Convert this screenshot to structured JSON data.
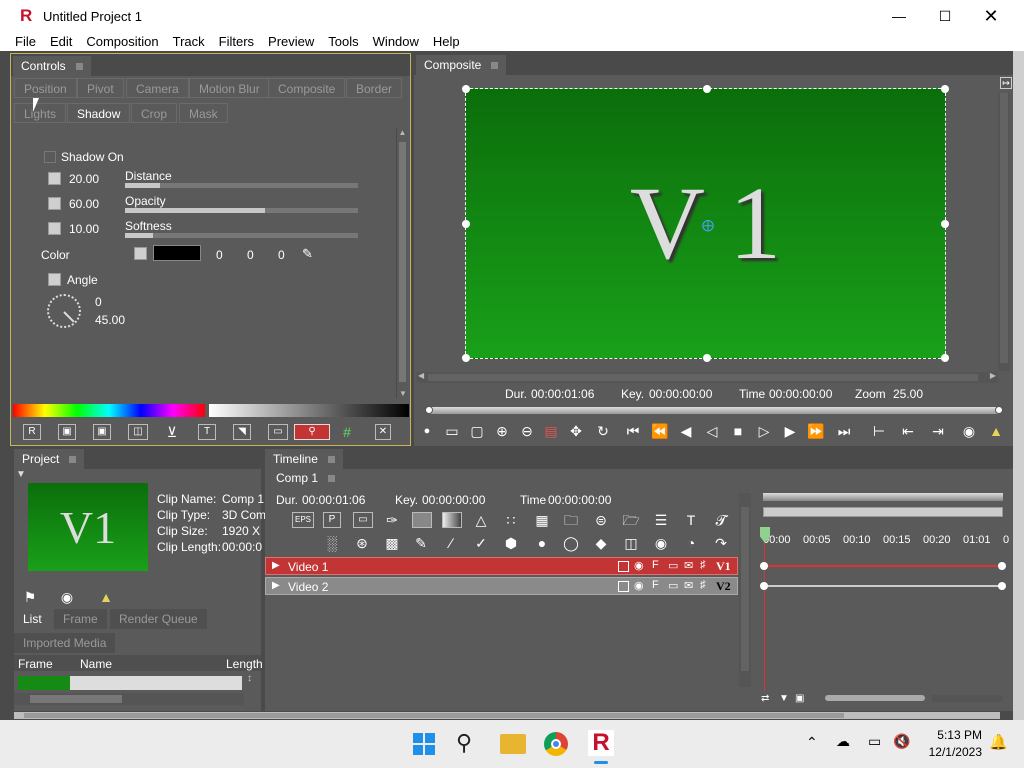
{
  "window": {
    "title": "Untitled Project 1"
  },
  "menu": [
    "File",
    "Edit",
    "Composition",
    "Track",
    "Filters",
    "Preview",
    "Tools",
    "Window",
    "Help"
  ],
  "controls": {
    "panel_title": "Controls",
    "tabs_row1": [
      "Position",
      "Pivot",
      "Camera",
      "Motion Blur",
      "Composite",
      "Border"
    ],
    "tabs_row2": [
      "Lights",
      "Shadow",
      "Crop",
      "Mask"
    ],
    "active_tab": "Shadow",
    "shadow_on_label": "Shadow On",
    "distance": {
      "value": "20.00",
      "label": "Distance",
      "level": 0.15
    },
    "opacity": {
      "value": "60.00",
      "label": "Opacity",
      "level": 0.6
    },
    "softness": {
      "value": "10.00",
      "label": "Softness",
      "level": 0.12
    },
    "color_label": "Color",
    "color_rgb": [
      "0",
      "0",
      "0"
    ],
    "color_value": "#000000",
    "angle_label": "Angle",
    "angle_values": [
      "0",
      "45.00"
    ]
  },
  "composite": {
    "panel_title": "Composite",
    "canvas_text": "V 1",
    "dur_label": "Dur.",
    "dur": "00:00:01:06",
    "key_label": "Key.",
    "key": "00:00:00:00",
    "time_label": "Time",
    "time": "00:00:00:00",
    "zoom_label": "Zoom",
    "zoom": "25.00",
    "bg_top": "#0b6e0b",
    "bg_bottom": "#19a019"
  },
  "project": {
    "panel_title": "Project",
    "thumb_text": "V1",
    "info": [
      {
        "label": "Clip Name:",
        "value": "Comp 1"
      },
      {
        "label": "Clip Type:",
        "value": "3D Com"
      },
      {
        "label": "Clip Size:",
        "value": "1920 X"
      },
      {
        "label": "Clip Length:",
        "value": "00:00:0"
      }
    ],
    "subtabs": [
      "List",
      "Frame",
      "Render Queue"
    ],
    "active_subtab": "List",
    "imported_media": "Imported Media",
    "columns": [
      "Frame",
      "Name",
      "Length"
    ]
  },
  "timeline": {
    "panel_title": "Timeline",
    "comp_tab": "Comp 1",
    "dur_label": "Dur.",
    "dur": "00:00:01:06",
    "key_label": "Key.",
    "key": "00:00:00:00",
    "time_label": "Time",
    "time": "00:00:00:00",
    "ruler": [
      "00:00",
      "00:05",
      "00:10",
      "00:15",
      "00:20",
      "01:01",
      "0"
    ],
    "tracks": [
      {
        "name": "Video 1",
        "tag": "V1",
        "color": "#c33434"
      },
      {
        "name": "Video 2",
        "tag": "V2",
        "color": "#8a8a8a"
      }
    ]
  },
  "taskbar": {
    "time": "5:13 PM",
    "date": "12/1/2023"
  }
}
